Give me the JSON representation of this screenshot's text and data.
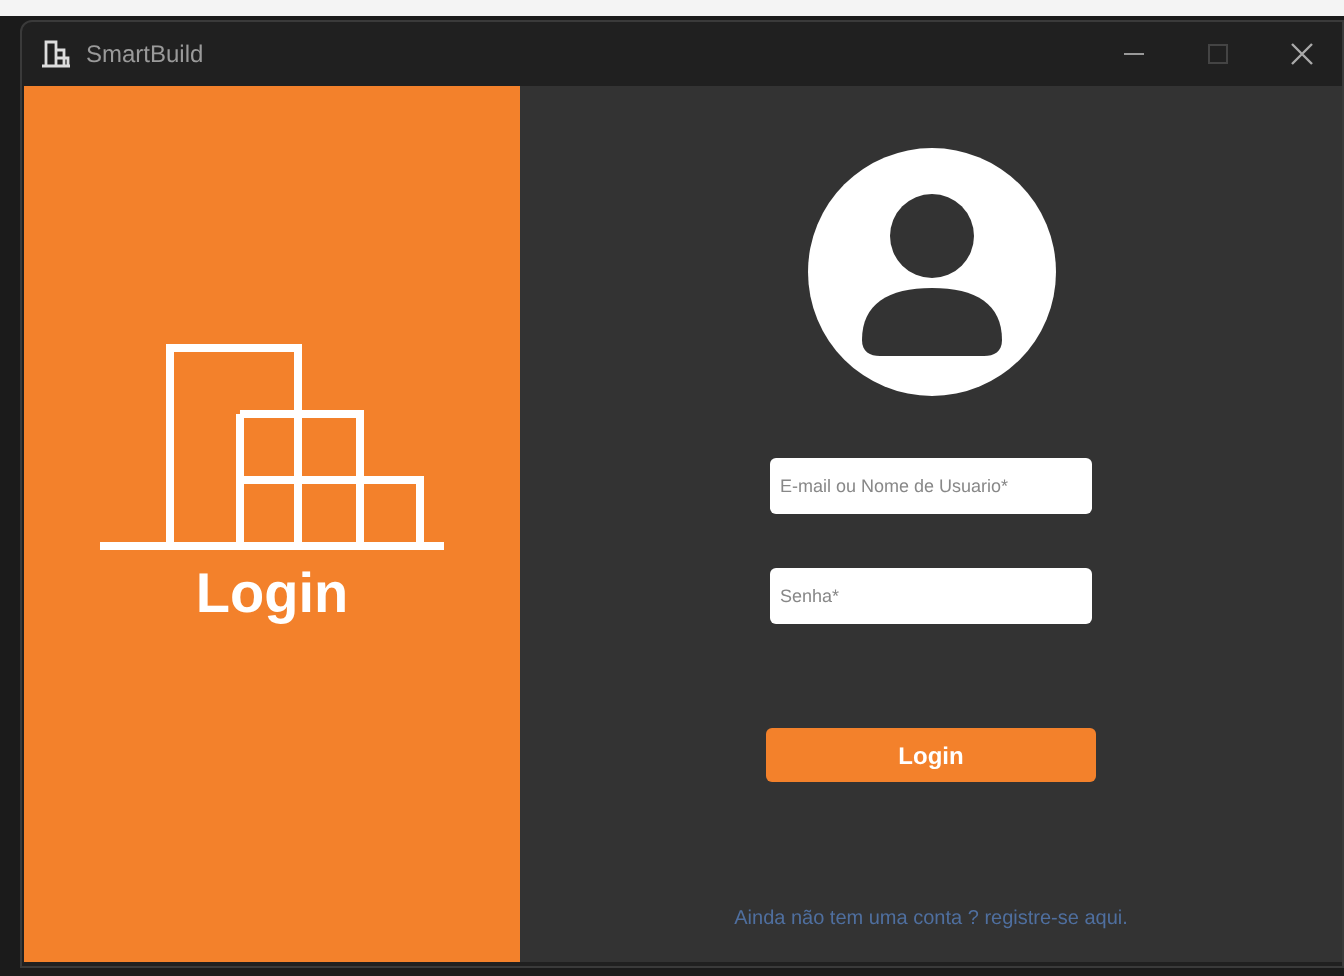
{
  "window": {
    "title": "SmartBuild"
  },
  "brand": {
    "title": "Login"
  },
  "form": {
    "fields": [
      {
        "placeholder": "E-mail ou Nome de Usuario*"
      },
      {
        "placeholder": "Senha*"
      }
    ],
    "button": "Login",
    "link": "Ainda não tem uma conta ? registre-se aqui."
  }
}
